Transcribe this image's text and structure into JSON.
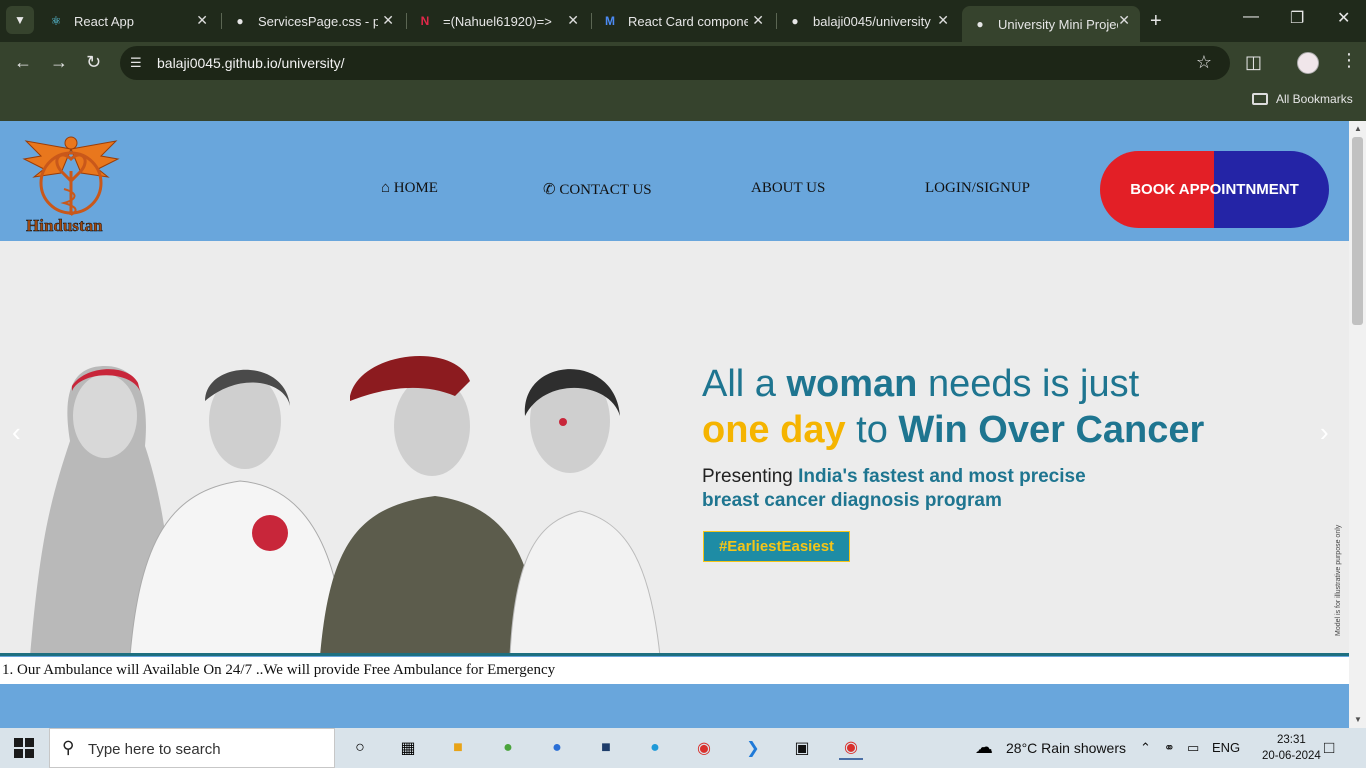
{
  "browser": {
    "tabs": [
      {
        "title": "React App",
        "icon": "react-icon"
      },
      {
        "title": "ServicesPage.css - po",
        "icon": "github-icon"
      },
      {
        "title": "=(Nahuel61920)=>",
        "icon": "n-brand-icon"
      },
      {
        "title": "React Card compone",
        "icon": "mui-icon"
      },
      {
        "title": "balaji0045/university",
        "icon": "github-icon"
      },
      {
        "title": "University Mini Projec",
        "icon": "globe-icon"
      }
    ],
    "url": "balaji0045.github.io/university/",
    "bookmarks_label": "All Bookmarks"
  },
  "site": {
    "logo_text": "Hindustan",
    "nav": {
      "home": "HOME",
      "contact": "CONTACT US",
      "about": "ABOUT US",
      "login": "LOGIN/SIGNUP"
    },
    "book_button": "BOOK APPOINTNMENT",
    "hero": {
      "line1_a": "All a ",
      "line1_b": "woman",
      "line1_c": " needs is just",
      "line2_a": "one day",
      "line2_b": " to ",
      "line2_c": "Win Over Cancer",
      "sub1_a": "Presenting ",
      "sub1_b": "India's fastest and most precise",
      "sub2": "breast cancer diagnosis program",
      "hashtag": "#EarliestEasiest",
      "disclaimer": "Model is for illustrative purpose only"
    },
    "marquee": "1. Our Ambulance will Available On 24/7 ..We will provide Free Ambulance for Emergency"
  },
  "taskbar": {
    "search_placeholder": "Type here to search",
    "weather": "28°C  Rain showers",
    "language": "ENG",
    "time": "23:31",
    "date": "20-06-2024"
  },
  "colors": {
    "header_blue": "#69a6dc",
    "button_red": "#e31f26",
    "button_blue": "#2424a6",
    "hero_teal": "#1e7590",
    "hero_yellow": "#f5b400"
  }
}
